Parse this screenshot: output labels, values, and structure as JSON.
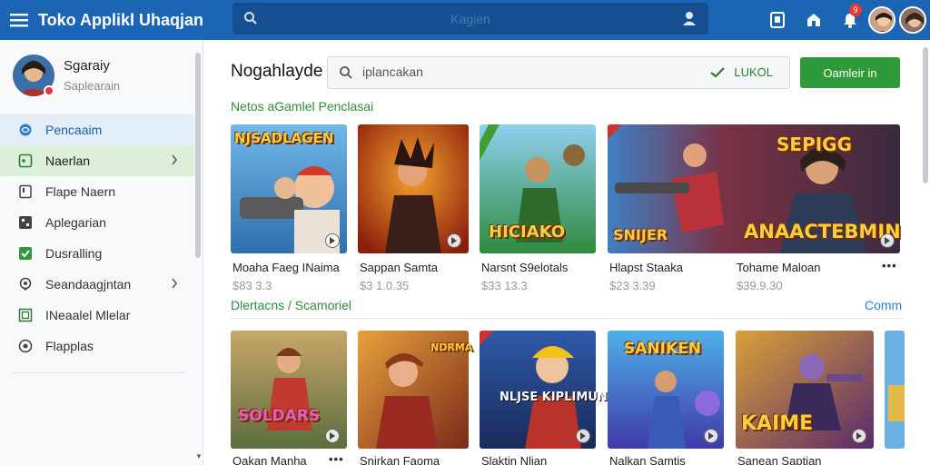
{
  "app": {
    "title": "Toko Applikl Uhaqjan"
  },
  "topbar": {
    "search_placeholder": "Kagien",
    "notification_count": "9",
    "icons": [
      "menu-icon",
      "search-icon",
      "user-search-icon",
      "tablet-icon",
      "store-icon",
      "notification-icon",
      "avatar"
    ]
  },
  "profile": {
    "name": "Sgaraiy",
    "subtitle": "Saplearain"
  },
  "sidebar": {
    "items": [
      {
        "label": "Pencaaim",
        "icon": "globe-icon"
      },
      {
        "label": "Naerlan",
        "icon": "image-icon"
      },
      {
        "label": "Flape Naern",
        "icon": "bookmark-icon"
      },
      {
        "label": "Aplegarian",
        "icon": "apps-icon"
      },
      {
        "label": "Dusralling",
        "icon": "check-icon"
      },
      {
        "label": "Seandaagjntan",
        "icon": "location-icon"
      },
      {
        "label": "INeaalel Mlelar",
        "icon": "grid-icon"
      },
      {
        "label": "Flapplas",
        "icon": "settings-icon"
      }
    ]
  },
  "main": {
    "title": "Nogahlayde",
    "search": {
      "value": "iplancakan",
      "status_label": "LUKOL"
    },
    "action_button": "Oamleir in",
    "section1": {
      "title": "Netos aGamlel Penclasai"
    },
    "section2": {
      "title": "Dlertacns / Scamoriel",
      "link": "Comm"
    },
    "row1": [
      {
        "name": "Moaha Faeg INaima",
        "price": "$83 3.3",
        "art_title": "NJSADLAGEN"
      },
      {
        "name": "Sappan Samta",
        "price": "$3 1.0.35",
        "art_title": ""
      },
      {
        "name": "Narsnt S9elotals",
        "price": "$33 13.3",
        "art_title": "HICIAKO"
      },
      {
        "name": "Hlapst Staaka",
        "price": "$23 3.39",
        "art_title": "SNIJER"
      },
      {
        "name": "Tohame Maloan",
        "price": "$39.9.30",
        "art_title": "SEPIGG"
      }
    ],
    "row1_wide_art": "ANAACTEBMIN",
    "row2": [
      {
        "name": "Oakan Manha",
        "art_title": "SOLDARS"
      },
      {
        "name": "Snirkan Faoma",
        "art_title": "NDRMA"
      },
      {
        "name": "Slaktin Nlian",
        "art_title": "NLJSE KIPLIMUN"
      },
      {
        "name": "Nalkan Samtis",
        "art_title": "SANIKEN"
      },
      {
        "name": "Sanean Saptian",
        "art_title": "KAIME"
      }
    ]
  },
  "colors": {
    "topbar": "#1c64b4",
    "accent_green": "#2e9a3a",
    "link_blue": "#2a7fd0"
  }
}
